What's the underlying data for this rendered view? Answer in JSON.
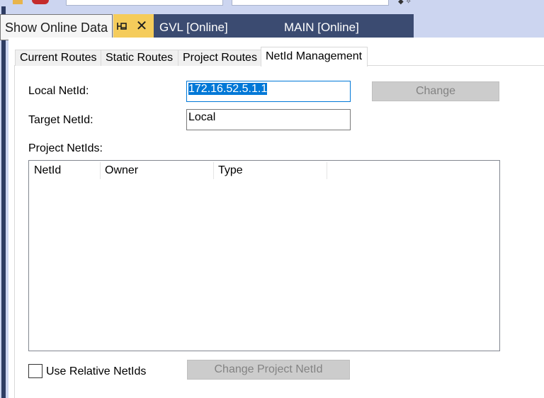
{
  "tooltip": {
    "text": "Show Online Data"
  },
  "editor_tabs": [
    {
      "label": "GVL [Online]"
    },
    {
      "label": "MAIN [Online]"
    }
  ],
  "inner_tabs": [
    {
      "label": "Current Routes"
    },
    {
      "label": "Static Routes"
    },
    {
      "label": "Project Routes"
    },
    {
      "label": "NetId Management",
      "active": true
    }
  ],
  "form": {
    "local_netid_label": "Local NetId:",
    "local_netid_value": "172.16.52.5.1.1",
    "target_netid_label": "Target NetId:",
    "target_netid_value": "Local",
    "change_button": "Change",
    "project_netids_label": "Project NetIds:"
  },
  "table": {
    "columns": [
      "NetId",
      "Owner",
      "Type"
    ],
    "rows": []
  },
  "footer": {
    "use_relative_label": "Use Relative NetIds",
    "use_relative_checked": false,
    "change_project_button": "Change Project NetId"
  },
  "colors": {
    "tab_active": "#f5cc5b",
    "tab_inactive": "#3b4b71",
    "chrome": "#ccd5f0",
    "selection": "#0078d7"
  }
}
